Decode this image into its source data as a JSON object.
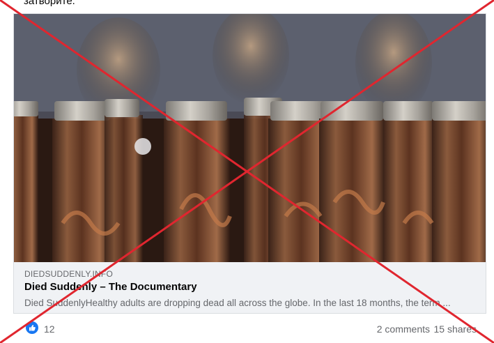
{
  "post": {
    "text_fragment": "затворите."
  },
  "link_preview": {
    "domain": "DIEDSUDDENLY.INFO",
    "title": "Died Suddenly – The Documentary",
    "description": "Died SuddenlyHealthy adults are dropping dead all across the globe. In the last 18 months, the term ..."
  },
  "footer": {
    "reaction_icon": "like-icon",
    "reaction_count": "12",
    "comments": "2 comments",
    "shares": "15 shares"
  },
  "overlay": {
    "color": "#e0262f"
  }
}
